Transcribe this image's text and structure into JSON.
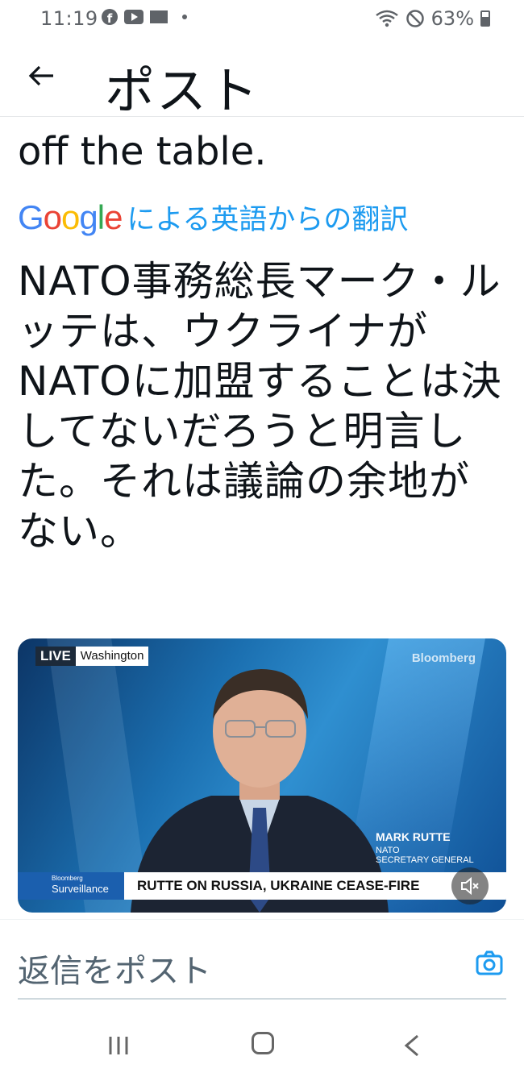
{
  "status_bar": {
    "time": "11:19",
    "battery": "63%",
    "icons": [
      "facebook-icon",
      "youtube-icon",
      "mail-icon",
      "dot-icon",
      "wifi-icon",
      "do-not-disturb-icon",
      "battery-icon"
    ]
  },
  "header": {
    "back_icon": "arrow-left-icon",
    "title": "ポスト"
  },
  "post": {
    "original_tail": "off the table.",
    "translation_label": "による英語からの翻訳",
    "google_logo": "Google",
    "translated_text": "NATO事務総長マーク・ルッテは、ウクライナがNATOに加盟することは決してないだろうと明言した。それは議論の余地がない。"
  },
  "video": {
    "live_label": "LIVE",
    "location": "Washington",
    "watermark": "Bloomberg",
    "speaker_name": "MARK RUTTE",
    "speaker_org": "NATO",
    "speaker_role": "SECRETARY GENERAL",
    "brand_small": "Bloomberg",
    "brand_show": "Surveillance",
    "headline": "RUTTE ON RUSSIA, UKRAINE CEASE-FIRE",
    "mute_icon": "volume-muted-icon"
  },
  "reply": {
    "placeholder": "返信をポスト",
    "camera_icon": "camera-icon"
  },
  "nav": {
    "items": [
      "recents-icon",
      "home-icon",
      "back-icon"
    ]
  },
  "colors": {
    "accent": "#1d9bf0",
    "text": "#0f1419",
    "muted": "#536471"
  }
}
